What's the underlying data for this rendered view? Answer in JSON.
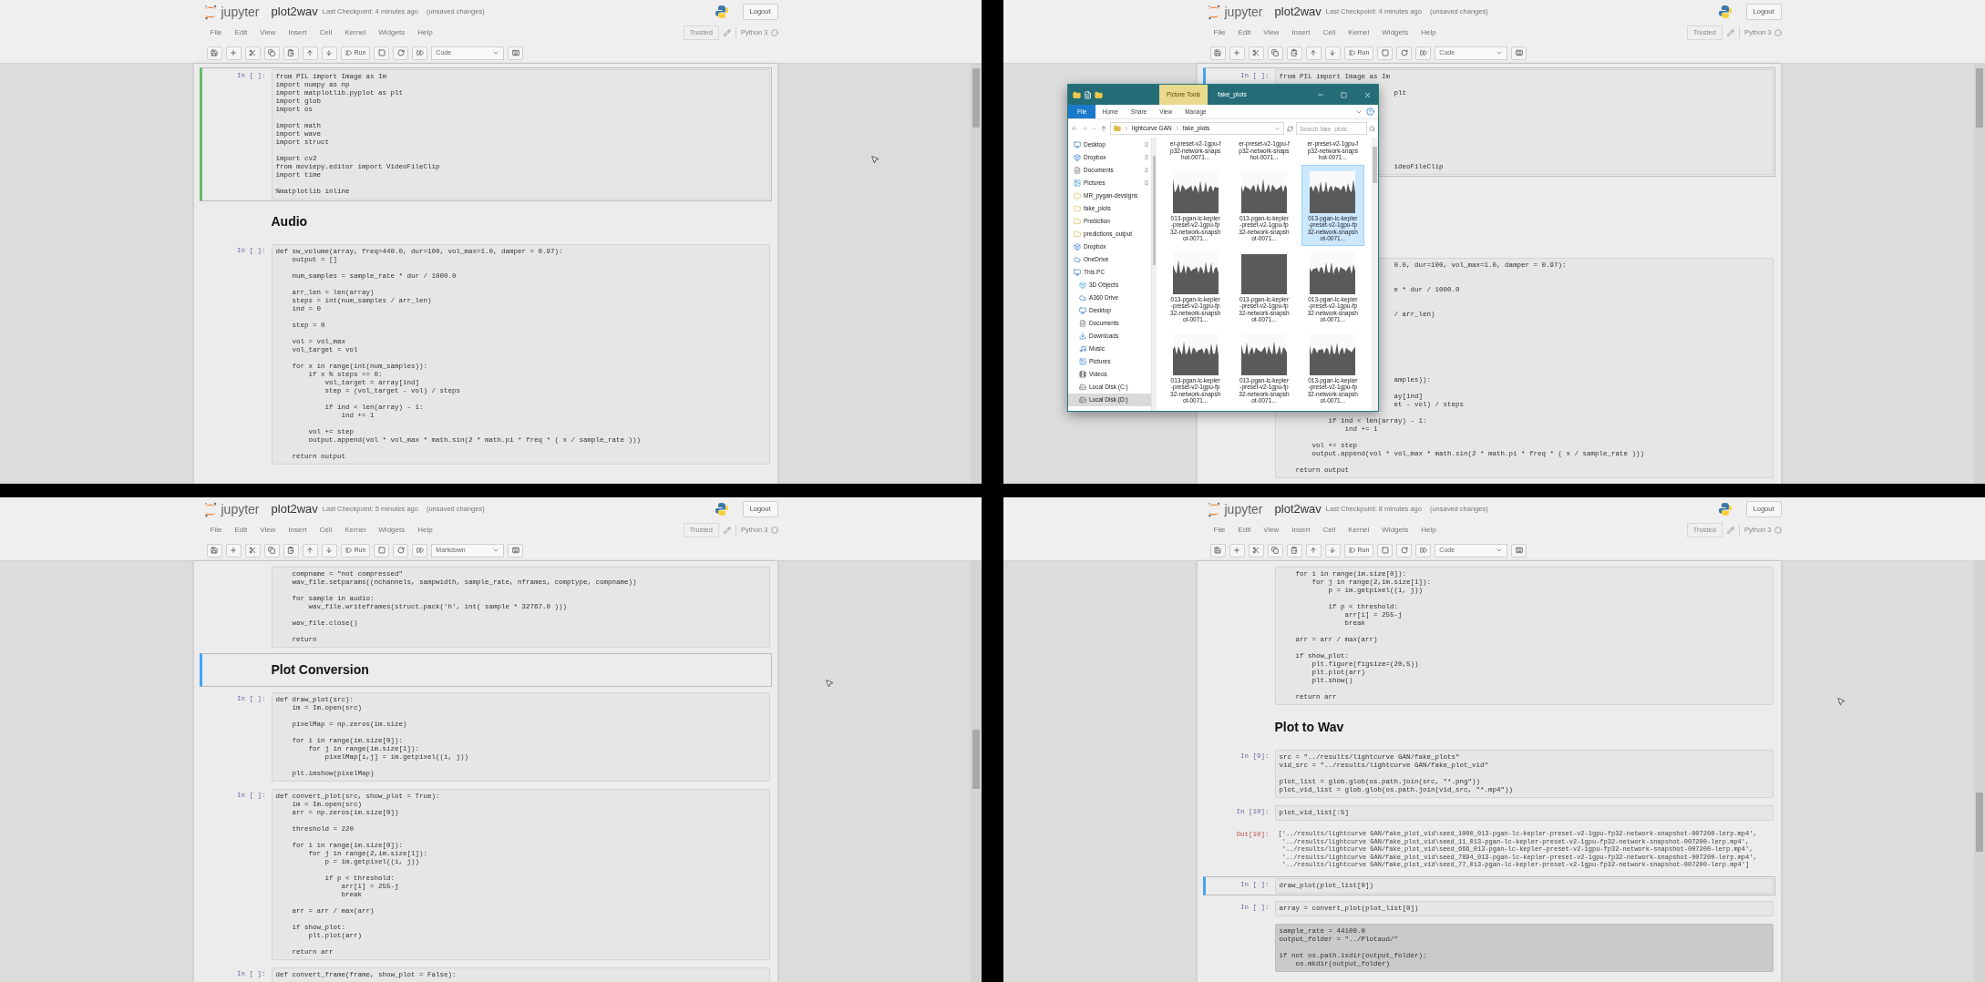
{
  "panels": [
    {
      "logo_text": "jupyter",
      "notebook": {
        "title": "plot2wav",
        "checkpoint": "Last Checkpoint: 4 minutes ago",
        "status": "(unsaved changes)"
      },
      "logout": "Logout",
      "menu": [
        "File",
        "Edit",
        "View",
        "Insert",
        "Cell",
        "Kernel",
        "Widgets",
        "Help"
      ],
      "trusted": "Trusted",
      "kernel": "Python 3",
      "toolbar": {
        "run": "Run",
        "cell_type": "Code"
      },
      "cells": [
        {
          "kind": "code",
          "prompt": "In [ ]:",
          "selected": true,
          "editing": true,
          "code": "from PIL import Image as Im\nimport numpy as np\nimport matplotlib.pyplot as plt\nimport glob\nimport os\n\nimport math\nimport wave\nimport struct\n\nimport cv2\nfrom moviepy.editor import VideoFileClip\nimport time\n\n%matplotlib inline"
        },
        {
          "kind": "heading",
          "text": "Audio",
          "selected": false
        },
        {
          "kind": "code",
          "prompt": "In [ ]:",
          "selected": false,
          "code": "def sw_volume(array, freq=440.0, dur=100, vol_max=1.0, damper = 0.97):\n    output = []\n\n    num_samples = sample_rate * dur / 1000.0\n\n    arr_len = len(array)\n    steps = int(num_samples / arr_len)\n    ind = 0\n\n    step = 0\n\n    vol = vol_max\n    vol_target = vol\n\n    for x in range(int(num_samples)):\n        if x % steps == 0:\n            vol_target = array[ind]\n            step = (vol_target - vol) / steps\n\n            if ind < len(array) - 1:\n                ind += 1\n\n        vol += step\n        output.append(vol * vol_max * math.sin(2 * math.pi * freq * ( x / sample_rate )))\n\n    return output"
        }
      ]
    },
    {
      "logo_text": "jupyter",
      "notebook": {
        "title": "plot2wav",
        "checkpoint": "Last Checkpoint: 4 minutes ago",
        "status": "(unsaved changes)"
      },
      "logout": "Logout",
      "menu": [
        "File",
        "Edit",
        "View",
        "Insert",
        "Cell",
        "Kernel",
        "Widgets",
        "Help"
      ],
      "trusted": "Trusted",
      "kernel": "Python 3",
      "toolbar": {
        "run": "Run",
        "cell_type": "Code"
      },
      "cells": [
        {
          "kind": "code",
          "prompt": "In [ ]:",
          "selected": true,
          "editing": false,
          "code": "from PIL import Image as Im\n\n                            plt\n\n\n\n\n\n\n\n\n                            ideoFileClip"
        },
        {
          "kind": "code",
          "selected": false,
          "code": "                            0.0, dur=100, vol_max=1.0, damper = 0.97):\n\n\n                            e * dur / 1000.0\n\n\n                            / arr_len)\n\n\n\n\n\n\n\n                            amples)):\n\n                            ay[ind]\n                            et - vol) / steps\n\n            if ind < len(array) - 1:\n                ind += 1\n\n        vol += step\n        output.append(vol * vol_max * math.sin(2 * math.pi * freq * ( x / sample_rate )))\n\n    return output"
        }
      ],
      "explorer": {
        "title": "fake_plots",
        "tool_tab": "Picture Tools",
        "ribbon": [
          {
            "label": "File",
            "kind": "file"
          },
          {
            "label": "Home",
            "kind": "tab"
          },
          {
            "label": "Share",
            "kind": "tab"
          },
          {
            "label": "View",
            "kind": "tab"
          },
          {
            "label": "Manage",
            "kind": "tab"
          }
        ],
        "path": [
          "lightcurve GAN",
          "fake_plots"
        ],
        "search": {
          "placeholder": "Search fake_plots"
        },
        "nav": [
          {
            "label": "Desktop",
            "kind": "desktop",
            "pinned": true,
            "selected": false
          },
          {
            "label": "Dropbox",
            "kind": "dropbox",
            "pinned": true,
            "selected": false
          },
          {
            "label": "Documents",
            "kind": "documents",
            "pinned": true,
            "selected": false
          },
          {
            "label": "Pictures",
            "kind": "pictures",
            "pinned": true,
            "selected": false
          },
          {
            "label": "MR_pygan-devsigns",
            "kind": "folder",
            "pinned": false,
            "selected": false
          },
          {
            "label": "fake_plots",
            "kind": "folder",
            "pinned": false,
            "selected": false
          },
          {
            "label": "Prediction",
            "kind": "folder",
            "pinned": false,
            "selected": false
          },
          {
            "label": "predictions_output",
            "kind": "folder",
            "pinned": false,
            "selected": false
          },
          {
            "label": "Dropbox",
            "kind": "dropbox",
            "pinned": false,
            "selected": false
          },
          {
            "label": "OneDrive",
            "kind": "cloud",
            "pinned": false,
            "selected": false
          },
          {
            "label": "This PC",
            "kind": "pc",
            "pinned": false,
            "selected": false,
            "children": [
              {
                "label": "3D Objects",
                "kind": "objects",
                "pinned": false,
                "selected": false
              },
              {
                "label": "A360 Drive",
                "kind": "cloud",
                "pinned": false,
                "selected": false
              },
              {
                "label": "Desktop",
                "kind": "desktop",
                "pinned": false,
                "selected": false
              },
              {
                "label": "Documents",
                "kind": "documents",
                "pinned": false,
                "selected": false
              },
              {
                "label": "Downloads",
                "kind": "downloads",
                "pinned": false,
                "selected": false
              },
              {
                "label": "Music",
                "kind": "music",
                "pinned": false,
                "selected": false
              },
              {
                "label": "Pictures",
                "kind": "pictures",
                "pinned": false,
                "selected": false
              },
              {
                "label": "Videos",
                "kind": "videos",
                "pinned": false,
                "selected": false
              },
              {
                "label": "Local Disk (C:)",
                "kind": "disk",
                "pinned": false,
                "selected": false
              },
              {
                "label": "Local Disk (D:)",
                "kind": "disk",
                "pinned": false,
                "selected": true
              }
            ]
          }
        ],
        "files": [
          {
            "kind": "partial",
            "caption": "er-preset-v2-1gpu-fp32-network-snapshot-0071...",
            "selected": false
          },
          {
            "kind": "partial",
            "caption": "er-preset-v2-1gpu-fp32-network-snapshot-0071...",
            "selected": false
          },
          {
            "kind": "partial",
            "caption": "er-preset-v2-1gpu-fp32-network-snapshot-0071...",
            "selected": false
          },
          {
            "kind": "full",
            "caption": "013-pgan-lc-kepler-preset-v2-1gpu-fp32-network-snapshot-0071...",
            "selected": false
          },
          {
            "kind": "full",
            "caption": "013-pgan-lc-kepler-preset-v2-1gpu-fp32-network-snapshot-0071...",
            "selected": false
          },
          {
            "kind": "full",
            "caption": "013-pgan-lc-kepler-preset-v2-1gpu-fp32-network-snapshot-0071...",
            "selected": true
          },
          {
            "kind": "full",
            "caption": "013-pgan-lc-kepler-preset-v2-1gpu-fp32-network-snapshot-0071...",
            "selected": false
          },
          {
            "kind": "full",
            "caption": "013-pgan-lc-kepler-preset-v2-1gpu-fp32-network-snapshot-0071...",
            "selected": false
          },
          {
            "kind": "full",
            "caption": "013-pgan-lc-kepler-preset-v2-1gpu-fp32-network-snapshot-0071...",
            "selected": false
          },
          {
            "kind": "full",
            "caption": "013-pgan-lc-kepler-preset-v2-1gpu-fp32-network-snapshot-0071...",
            "selected": false
          },
          {
            "kind": "full",
            "caption": "013-pgan-lc-kepler-preset-v2-1gpu-fp32-network-snapshot-0071...",
            "selected": false
          },
          {
            "kind": "full",
            "caption": "013-pgan-lc-kepler-preset-v2-1gpu-fp32-network-snapshot-0071...",
            "selected": false
          }
        ]
      }
    },
    {
      "logo_text": "jupyter",
      "notebook": {
        "title": "plot2wav",
        "checkpoint": "Last Checkpoint: 5 minutes ago",
        "status": "(unsaved changes)"
      },
      "logout": "Logout",
      "menu": [
        "File",
        "Edit",
        "View",
        "Insert",
        "Cell",
        "Kernel",
        "Widgets",
        "Help"
      ],
      "trusted": "Trusted",
      "kernel": "Python 3",
      "toolbar": {
        "run": "Run",
        "cell_type": "Markdown"
      },
      "cells": [
        {
          "kind": "code",
          "selected": false,
          "code": "    compname = \"not compressed\"\n    wav_file.setparams((nchannels, sampwidth, sample_rate, nframes, comptype, compname))\n\n    for sample in audio:\n        wav_file.writeframes(struct.pack('h', int( sample * 32767.0 )))\n\n    wav_file.close()\n\n    return"
        },
        {
          "kind": "heading",
          "text": "Plot Conversion",
          "selected": true,
          "editing": false
        },
        {
          "kind": "code",
          "prompt": "In [ ]:",
          "selected": false,
          "code": "def draw_plot(src):\n    im = Im.open(src)\n\n    pixelMap = np.zeros(im.size)\n\n    for i in range(im.size[0]):\n        for j in range(im.size[1]):\n            pixelMap[i,j] = im.getpixel((i, j))\n\n    plt.imshow(pixelMap)"
        },
        {
          "kind": "code",
          "prompt": "In [ ]:",
          "selected": false,
          "code": "def convert_plot(src, show_plot = True):\n    im = Im.open(src)\n    arr = np.zeros(im.size[0])\n\n    threshold = 220\n\n    for i in range(im.size[0]):\n        for j in range(2,im.size[1]):\n            p = im.getpixel((i, j))\n\n            if p < threshold:\n                arr[i] = 255-j\n                break\n\n    arr = arr / max(arr)\n\n    if show_plot:\n        plt.plot(arr)\n\n    return arr"
        },
        {
          "kind": "code",
          "prompt": "In [ ]:",
          "selected": false,
          "code": "def convert_frame(frame, show_plot = False):"
        }
      ]
    },
    {
      "logo_text": "jupyter",
      "notebook": {
        "title": "plot2wav",
        "checkpoint": "Last Checkpoint: 8 minutes ago",
        "status": "(unsaved changes)"
      },
      "logout": "Logout",
      "menu": [
        "File",
        "Edit",
        "View",
        "Insert",
        "Cell",
        "Kernel",
        "Widgets",
        "Help"
      ],
      "trusted": "Trusted",
      "kernel": "Python 3",
      "toolbar": {
        "run": "Run",
        "cell_type": "Code"
      },
      "cells": [
        {
          "kind": "code",
          "selected": false,
          "highlighted": false,
          "code": "    for i in range(im.size[0]):\n        for j in range(2,im.size[1]):\n            p = im.getpixel((i, j))\n\n            if p < threshold:\n                arr[i] = 255-j\n                break\n\n    arr = arr / max(arr)\n\n    if show_plot:\n        plt.figure(figsize=(20,5))\n        plt.plot(arr)\n        plt.show()\n\n    return arr"
        },
        {
          "kind": "heading",
          "text": "Plot to Wav",
          "selected": false
        },
        {
          "kind": "code",
          "prompt": "In [9]:",
          "selected": false,
          "highlighted": false,
          "code": "src = \"../results/lightcurve GAN/fake_plots\"\nvid_src = \"../results/lightcurve GAN/fake_plot_vid\"\n\nplot_list = glob.glob(os.path.join(src, \"*.png\"))\nplot_vid_list = glob.glob(os.path.join(vid_src, \"*.mp4\"))"
        },
        {
          "kind": "code",
          "prompt": "In [10]:",
          "selected": false,
          "highlighted": false,
          "code": "plot_vid_list[:5]"
        },
        {
          "kind": "output",
          "prompt": "Out[10]:",
          "selected": false,
          "text": "['../results/lightcurve GAN/fake_plot_vid\\seed_1000_013-pgan-lc-kepler-preset-v2-1gpu-fp32-network-snapshot-007200-lerp.mp4',\n '../results/lightcurve GAN/fake_plot_vid\\seed_11_013-pgan-lc-kepler-preset-v2-1gpu-fp32-network-snapshot-007200-lerp.mp4',\n '../results/lightcurve GAN/fake_plot_vid\\seed_666_013-pgan-lc-kepler-preset-v2-1gpu-fp32-network-snapshot-007200-lerp.mp4',\n '../results/lightcurve GAN/fake_plot_vid\\seed_7894_013-pgan-lc-kepler-preset-v2-1gpu-fp32-network-snapshot-007200-lerp.mp4',\n '../results/lightcurve GAN/fake_plot_vid\\seed_77_013-pgan-lc-kepler-preset-v2-1gpu-fp32-network-snapshot-007200-lerp.mp4']"
        },
        {
          "kind": "code",
          "prompt": "In [ ]:",
          "selected": true,
          "editing": false,
          "highlighted": false,
          "code": "draw_plot(plot_list[0])"
        },
        {
          "kind": "code",
          "prompt": "In [ ]:",
          "selected": false,
          "highlighted": false,
          "code": "array = convert_plot(plot_list[0])"
        },
        {
          "kind": "code",
          "selected": false,
          "highlighted": true,
          "code": "sample_rate = 44100.0\noutput_folder = \"../Plotaud/\"\n\nif not os.path.isdir(output_folder):\n    os.mkdir(output_folder)"
        }
      ]
    }
  ]
}
